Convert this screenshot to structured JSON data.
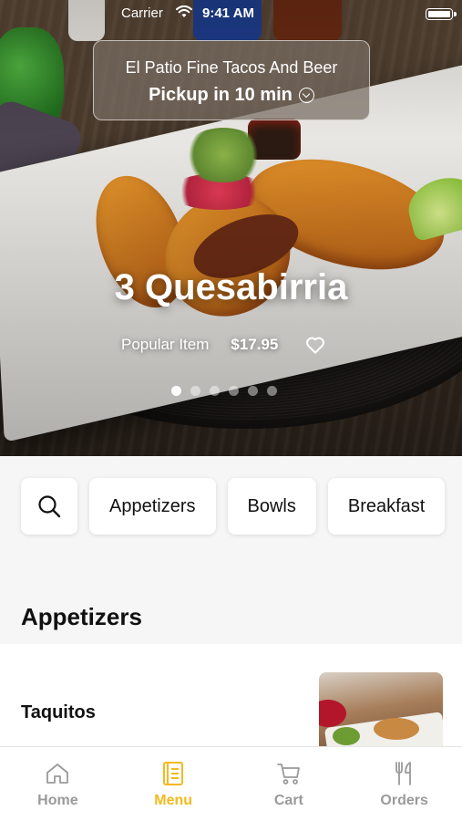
{
  "status_bar": {
    "carrier": "Carrier",
    "time": "9:41 AM",
    "wifi_icon": "wifi-icon",
    "battery_icon": "battery-icon"
  },
  "pickup": {
    "restaurant_name": "El Patio Fine Tacos And Beer",
    "eta_label": "Pickup in 10 min",
    "chevron_icon": "chevron-down-circle-icon"
  },
  "hero": {
    "dish_name": "3 Quesabirria",
    "tag": "Popular Item",
    "price": "$17.95",
    "favorite_icon": "heart-icon",
    "carousel_page": 1,
    "carousel_total": 6
  },
  "categories": {
    "search_icon": "search-icon",
    "items": [
      "Appetizers",
      "Bowls",
      "Breakfast"
    ]
  },
  "section": {
    "title": "Appetizers",
    "items": [
      {
        "name": "Taquitos"
      }
    ]
  },
  "tab_bar": {
    "active": "Menu",
    "tabs": [
      {
        "label": "Home",
        "icon": "home-icon"
      },
      {
        "label": "Menu",
        "icon": "menu-book-icon"
      },
      {
        "label": "Cart",
        "icon": "cart-icon"
      },
      {
        "label": "Orders",
        "icon": "fork-knife-icon"
      }
    ]
  },
  "colors": {
    "accent": "#f3b91e",
    "inactive_tab": "#9a9a9a",
    "background": "#f6f6f6"
  }
}
